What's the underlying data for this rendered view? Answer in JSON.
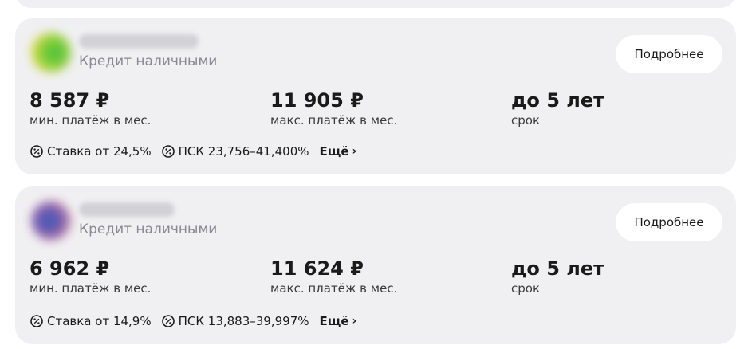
{
  "offers": [
    {
      "bank_name": "",
      "product": "Кредит наличными",
      "details_button": "Подробнее",
      "min_payment": {
        "value": "8 587 ₽",
        "label": "мин. платёж в мес."
      },
      "max_payment": {
        "value": "11 905 ₽",
        "label": "макс. платёж в мес."
      },
      "term": {
        "value": "до 5 лет",
        "label": "срок"
      },
      "rate": "Ставка от 24,5%",
      "psk": "ПСК 23,756–41,400%",
      "more": "Ещё",
      "logo_colors": [
        "#3fbf3f",
        "#e6d94a"
      ]
    },
    {
      "bank_name": "",
      "product": "Кредит наличными",
      "details_button": "Подробнее",
      "min_payment": {
        "value": "6 962 ₽",
        "label": "мин. платёж в мес."
      },
      "max_payment": {
        "value": "11 624 ₽",
        "label": "макс. платёж в мес."
      },
      "term": {
        "value": "до 5 лет",
        "label": "срок"
      },
      "rate": "Ставка от 14,9%",
      "psk": "ПСК 13,883–39,997%",
      "more": "Ещё",
      "logo_colors": [
        "#3a57b8",
        "#d88aa0"
      ]
    }
  ],
  "icons": {
    "percent": "percent-circle-icon",
    "chevron": "chevron-right-icon"
  },
  "colors": {
    "card_background": "#f0f0f2",
    "secondary_text": "#8a8a8e"
  }
}
